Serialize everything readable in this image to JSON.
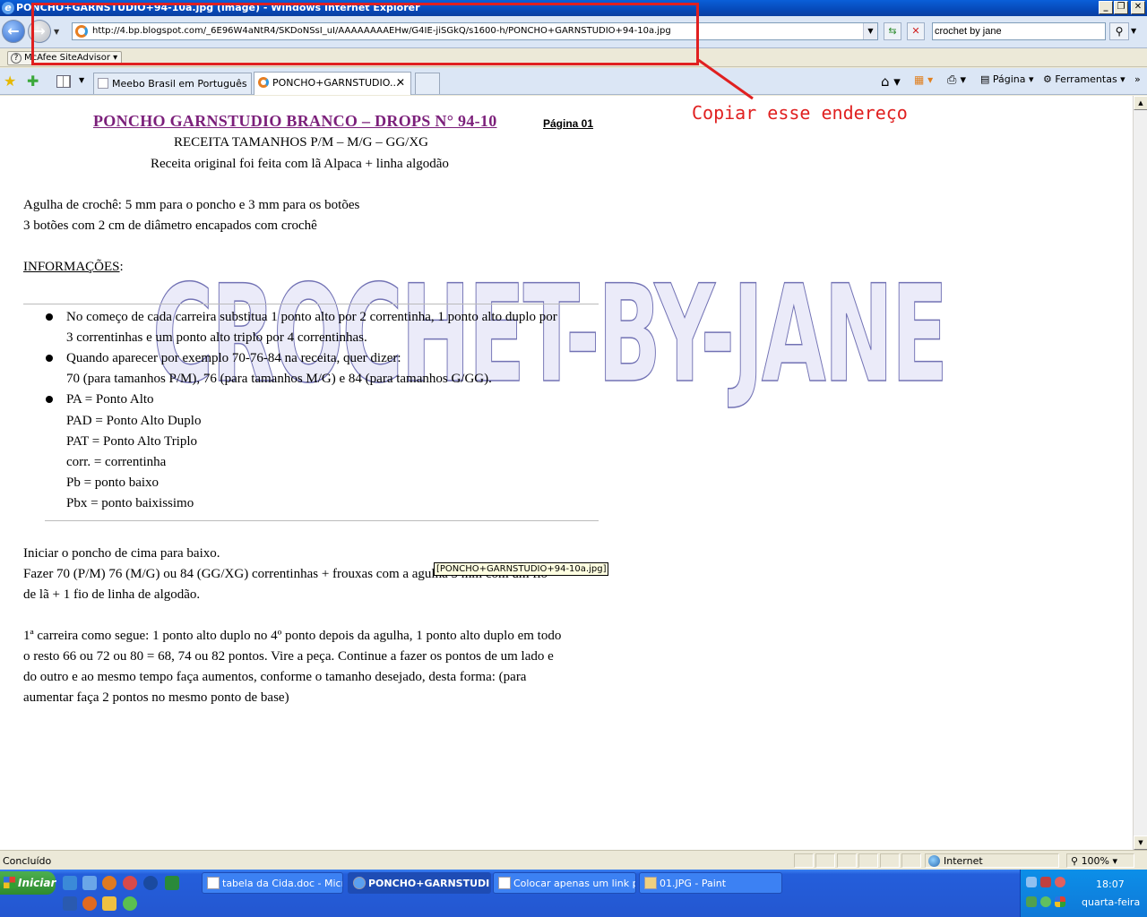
{
  "window": {
    "title": "PONCHO+GARNSTUDIO+94-10a.jpg (image) - Windows Internet Explorer"
  },
  "address": {
    "url": "http://4.bp.blogspot.com/_6E96W4aNtR4/SKDoNSsI_uI/AAAAAAAAEHw/G4IE-jiSGkQ/s1600-h/PONCHO+GARNSTUDIO+94-10a.jpg"
  },
  "search": {
    "value": "crochet by jane"
  },
  "mcafee": {
    "label": "McAfee SiteAdvisor"
  },
  "tabs": [
    {
      "label": "Meebo Brasil em Português B...",
      "active": false
    },
    {
      "label": "PONCHO+GARNSTUDIO...",
      "active": true
    }
  ],
  "toolbar": {
    "pagina_label": "Página",
    "ferramentas_label": "Ferramentas"
  },
  "annotation": {
    "text": "Copiar esse endereço",
    "color": "#e02020"
  },
  "document": {
    "title": "PONCHO GARNSTUDIO BRANCO – DROPS N° 94-10",
    "page_label": "Página 01",
    "subtitle1": "RECEITA TAMANHOS P/M – M/G – GG/XG",
    "subtitle2": "Receita original foi feita com lã Alpaca +  linha algodão",
    "needle1": "Agulha de crochê: 5 mm para o poncho e 3 mm para os botões",
    "needle2": "3 botões com 2 cm de diâmetro encapados com crochê",
    "info_heading": "INFORMAÇÕES",
    "info_colon": ":",
    "bullet1_l1": "No começo de cada carreira substitua 1 ponto alto por 2 correntinha, 1 ponto alto duplo por",
    "bullet1_l2": "3 correntinhas e um ponto alto triplo por 4 correntinhas.",
    "bullet2_l1": "Quando aparecer por exemplo 70-76-84 na receita, quer dizer:",
    "bullet2_l2": "70 (para tamanhos P/M), 76 (para tamanhos M/G) e 84 (para tamanhos G/GG).",
    "abbr": [
      "PA = Ponto Alto",
      "PAD = Ponto Alto Duplo",
      "PAT = Ponto Alto Triplo",
      "corr. = correntinha",
      "Pb = ponto baixo",
      "Pbx = ponto baixissimo"
    ],
    "para1": "Iniciar o poncho de cima para baixo.",
    "para2_l1": "Fazer 70 (P/M) 76 (M/G) ou 84 (GG/XG) correntinhas + frouxas com a agulha 5 mm com um fio",
    "para2_l2": "de lã + 1 fio de  linha de algodão.",
    "para3_l1": "1ª carreira como segue: 1 ponto alto duplo no 4º ponto depois da agulha, 1 ponto alto duplo em todo",
    "para3_l2": "o resto 66 ou 72 ou 80  = 68, 74 ou 82 pontos. Vire a peça. Continue a fazer os pontos de um lado e",
    "para3_l3": "do outro e ao mesmo tempo faça aumentos, conforme o tamanho desejado, desta forma: (para",
    "para3_l4": "aumentar faça 2 pontos no mesmo ponto de base)",
    "watermark": "CROCHET-BY-JANE",
    "tooltip": "[PONCHO+GARNSTUDIO+94-10a.jpg]"
  },
  "status": {
    "text": "Concluído",
    "zone": "Internet",
    "zoom": "100%"
  },
  "taskbar": {
    "start_label": "Iniciar",
    "buttons": [
      {
        "label": "tabela da Cida.doc - Micr...",
        "active": false
      },
      {
        "label": "PONCHO+GARNSTUDI...",
        "active": true
      },
      {
        "label": "Colocar apenas um link p...",
        "active": false
      },
      {
        "label": "01.JPG - Paint",
        "active": false
      }
    ],
    "clock": "18:07",
    "day": "quarta-feira"
  }
}
